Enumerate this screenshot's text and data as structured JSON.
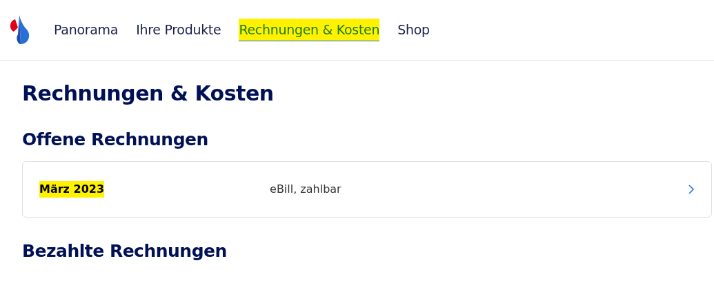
{
  "nav": {
    "items": [
      {
        "label": "Panorama",
        "selected": false,
        "highlighted": false
      },
      {
        "label": "Ihre Produkte",
        "selected": false,
        "highlighted": false
      },
      {
        "label": "Rechnungen & Kosten",
        "selected": true,
        "highlighted": true
      },
      {
        "label": "Shop",
        "selected": false,
        "highlighted": false
      }
    ]
  },
  "page_title": "Rechnungen & Kosten",
  "sections": [
    {
      "title": "Offene Rechnungen",
      "invoices": [
        {
          "period": "März 2023",
          "highlighted": true,
          "detail": "eBill, zahlbar"
        }
      ]
    },
    {
      "title": "Bezahlte Rechnungen"
    }
  ]
}
